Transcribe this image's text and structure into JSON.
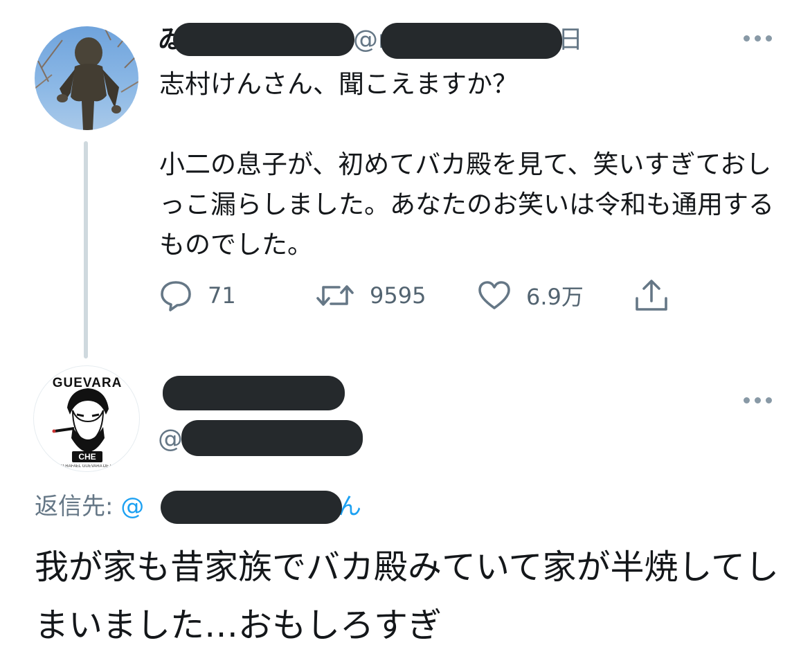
{
  "tweet": {
    "handle_prefix": "@r",
    "date_char": "日",
    "text": "志村けんさん、聞こえますか？\n\n小二の息子が、初めてバカ殿を見て、笑いすぎておしっこ漏らしました。あなたのお笑いは令和も通用するものでした。",
    "actions": {
      "reply_count": "71",
      "retweet_count": "9595",
      "like_count": "6.9万"
    }
  },
  "reply": {
    "avatar_title": "GUEVARA",
    "avatar_badge": "CHE",
    "avatar_caption": "ERNESTO RAFAEL GUEVARA DE LA SERNA",
    "handle_prefix": "@",
    "reply_to_label": "返信先: ",
    "reply_to_at": "@",
    "reply_to_suffix": "ん",
    "text": "我が家も昔家族でバカ殿みていて家が半焼してしまいました…おもしろすぎ"
  },
  "colors": {
    "text": "#14171a",
    "secondary": "#657786",
    "link": "#1da1f2",
    "thread_line": "#cfd9de",
    "redaction": "#25292c"
  }
}
